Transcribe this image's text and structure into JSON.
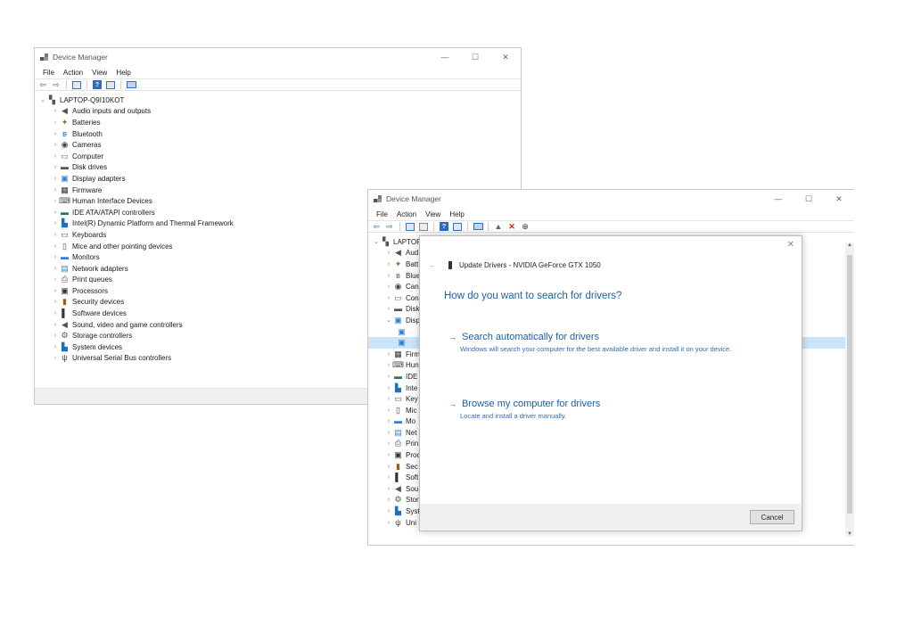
{
  "window1": {
    "title": "Device Manager",
    "menu": [
      "File",
      "Action",
      "View",
      "Help"
    ],
    "root": "LAPTOP-Q9I10KOT",
    "items": [
      "Audio inputs and outputs",
      "Batteries",
      "Bluetooth",
      "Cameras",
      "Computer",
      "Disk drives",
      "Display adapters",
      "Firmware",
      "Human Interface Devices",
      "IDE ATA/ATAPI controllers",
      "Intel(R) Dynamic Platform and Thermal Framework",
      "Keyboards",
      "Mice and other pointing devices",
      "Monitors",
      "Network adapters",
      "Print queues",
      "Processors",
      "Security devices",
      "Software devices",
      "Sound, video and game controllers",
      "Storage controllers",
      "System devices",
      "Universal Serial Bus controllers"
    ]
  },
  "window2": {
    "title": "Device Manager",
    "menu": [
      "File",
      "Action",
      "View",
      "Help"
    ],
    "root": "LAPTOP",
    "items": [
      "Aud",
      "Batt",
      "Blue",
      "Can",
      "Con",
      "Disk",
      "Disp",
      "",
      "",
      "Firm",
      "Hun",
      "IDE",
      "Inte",
      "Key",
      "Mic",
      "Mo",
      "Net",
      "Prin",
      "Proc",
      "Sec",
      "Soft",
      "Sou",
      "Stor",
      "Syst",
      "Uni"
    ]
  },
  "dialog": {
    "header": "Update Drivers - NVIDIA GeForce GTX 1050",
    "question": "How do you want to search for drivers?",
    "option1_title": "Search automatically for drivers",
    "option1_desc": "Windows will search your computer for the best available driver and install it on your device.",
    "option2_title": "Browse my computer for drivers",
    "option2_desc": "Locate and install a driver manually.",
    "cancel": "Cancel",
    "close_glyph": "✕",
    "back_glyph": "←",
    "arrow_glyph": "→"
  },
  "captions": {
    "minimize": "—",
    "maximize": "☐",
    "close": "✕"
  },
  "icons": [
    "device-manager-icon",
    "back-icon",
    "forward-icon",
    "properties-icon",
    "help-icon",
    "monitor-icon",
    "update-driver-icon",
    "uninstall-icon",
    "download-icon"
  ]
}
